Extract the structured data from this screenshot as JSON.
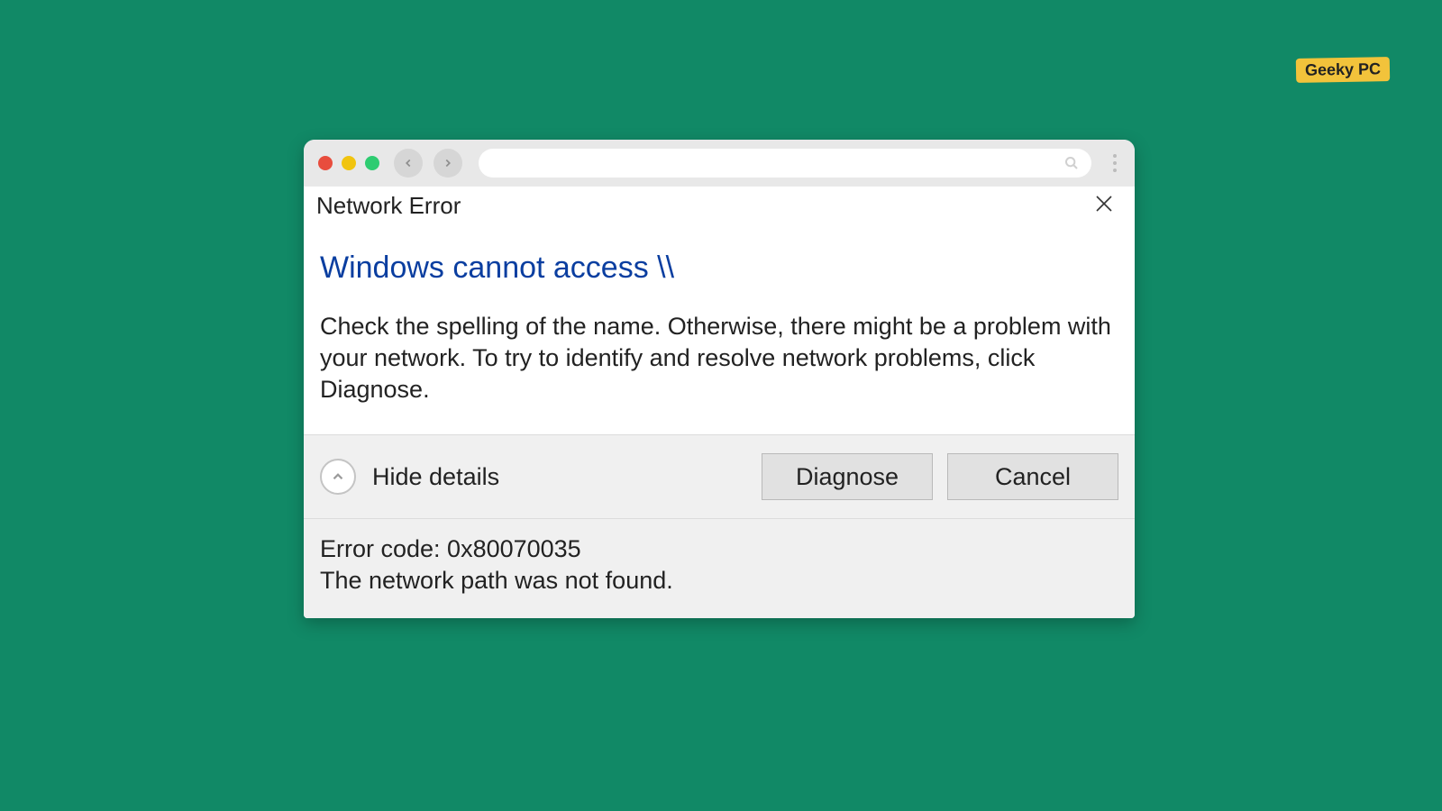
{
  "watermark": {
    "label": "Geeky PC"
  },
  "dialog": {
    "title": "Network Error",
    "headline": "Windows cannot access \\\\",
    "body": "Check the spelling of the name. Otherwise, there might be a problem with your network. To try to identify and resolve network problems, click Diagnose.",
    "toggle_label": "Hide details",
    "buttons": {
      "diagnose": "Diagnose",
      "cancel": "Cancel"
    },
    "details": {
      "line1": "Error code: 0x80070035",
      "line2": "The network path was not found."
    }
  }
}
